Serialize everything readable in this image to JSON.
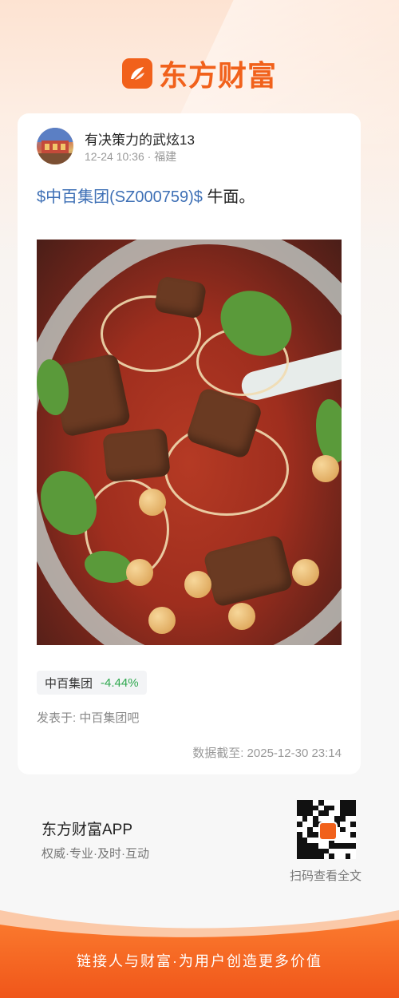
{
  "brand": {
    "logo_text": "东方财富",
    "accent_color": "#f1611b",
    "logo_icon": "eastmoney-logo-icon"
  },
  "post": {
    "author": "有决策力的武炫13",
    "time": "12-24 10:36",
    "separator": "·",
    "location": "福建",
    "stock_link": "$中百集团(SZ000759)$",
    "text": "牛面。",
    "image_description_icon": "noodle-photo"
  },
  "stock_tag": {
    "name": "中百集团",
    "change": "-4.44%",
    "change_color": "#2fa84f"
  },
  "posted_in": "发表于: 中百集团吧",
  "data_cutoff": "数据截至: 2025-12-30 23:14",
  "app": {
    "name": "东方财富APP",
    "slogan": "权威·专业·及时·互动",
    "qr_caption": "扫码查看全文"
  },
  "footer": {
    "text": "链接人与财富·为用户创造更多价值"
  }
}
